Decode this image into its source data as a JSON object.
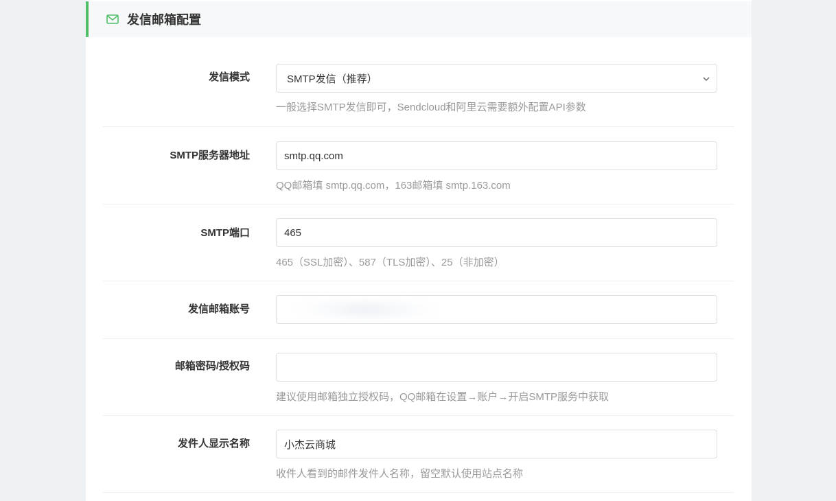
{
  "section": {
    "icon": "mail-icon",
    "title": "发信邮箱配置",
    "accent": "#4fbf6a"
  },
  "fields": [
    {
      "label": "发信模式",
      "type": "select",
      "value": "SMTP发信（推荐）",
      "hint": "一般选择SMTP发信即可，Sendcloud和阿里云需要额外配置API参数"
    },
    {
      "label": "SMTP服务器地址",
      "type": "text",
      "value": "smtp.qq.com",
      "hint": "QQ邮箱填 smtp.qq.com，163邮箱填 smtp.163.com"
    },
    {
      "label": "SMTP端口",
      "type": "text",
      "value": "465",
      "hint": "465（SSL加密）、587（TLS加密）、25（非加密）"
    },
    {
      "label": "发信邮箱账号",
      "type": "text",
      "value": "",
      "hint": ""
    },
    {
      "label": "邮箱密码/授权码",
      "type": "password",
      "value": "",
      "hint": "建议使用邮箱独立授权码，QQ邮箱在设置→账户→开启SMTP服务中获取"
    },
    {
      "label": "发件人显示名称",
      "type": "text",
      "value": "小杰云商城",
      "hint": "收件人看到的邮件发件人名称，留空默认使用站点名称"
    }
  ]
}
